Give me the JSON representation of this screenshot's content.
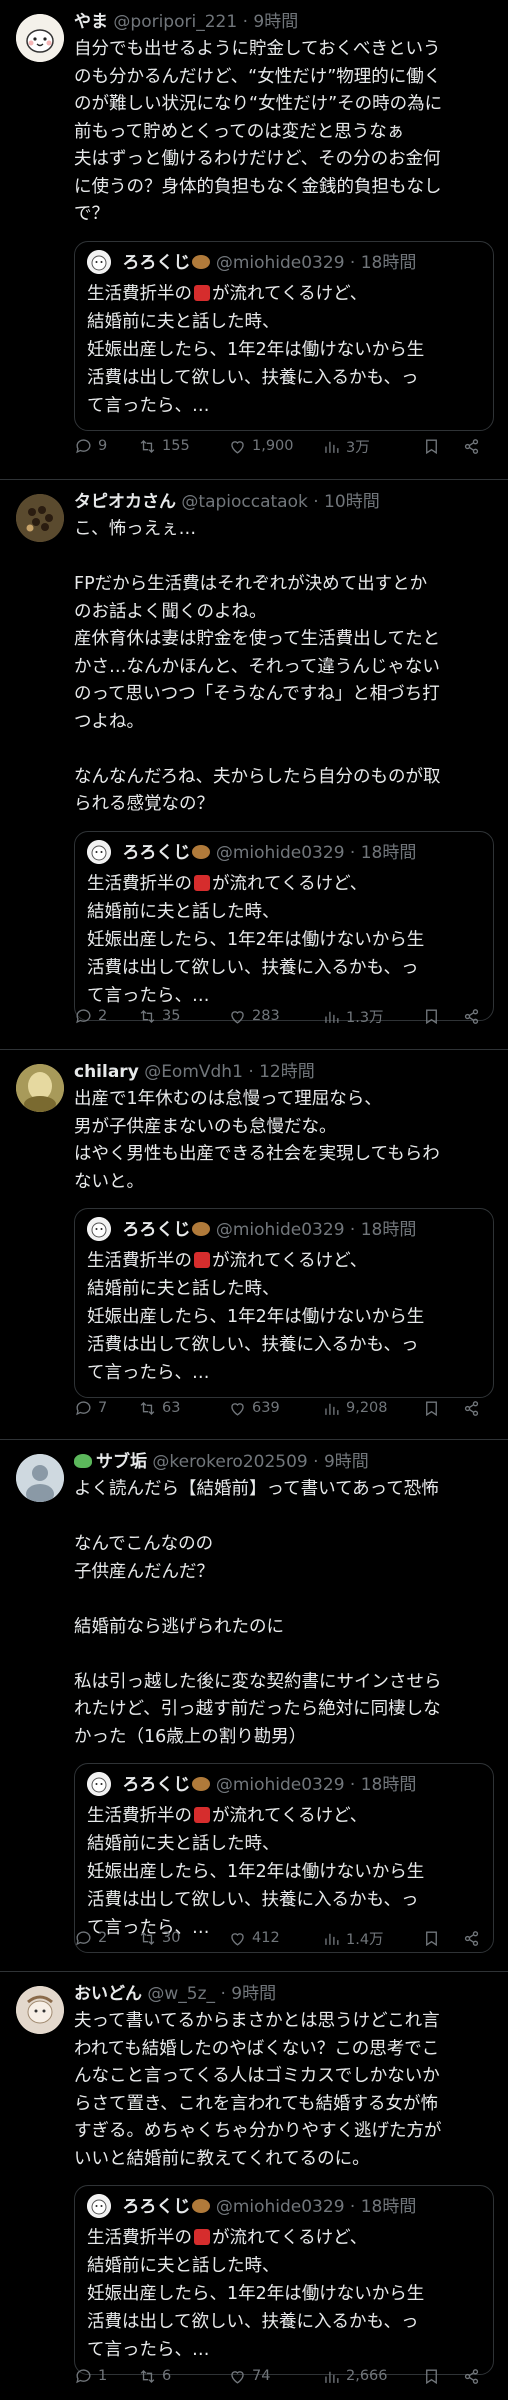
{
  "colors": {
    "background": "#000000",
    "text": "#e7e9ea",
    "muted": "#71767b",
    "border": "#2f3336"
  },
  "tweets": [
    {
      "name": "やま",
      "handle": "@poripori_221",
      "time": "· 9時間",
      "text": "自分でも出せるように貯金しておくべきという\nのも分かるんだけど、“女性だけ”物理的に働く\nのが難しい状況になり“女性だけ”その時の為に\n前もって貯めとくってのは変だと思うなぁ\n夫はずっと働けるわけだけど、その分のお金何\nに使うの？身体的負担もなく金銭的負担もなし\nで？",
      "quote": {
        "name": "ろろくじ",
        "handle": "@miohide0329",
        "time": "· 18時間",
        "line1_pre": "生活費折半の",
        "line1_post": "が流れてくるけど、",
        "rest": "結婚前に夫と話した時、\n妊娠出産したら、1年2年は働けないから生\n活費は出して欲しい、扶養に入るかも、っ\nて言ったら、…"
      },
      "replies": "9",
      "retweets": "155",
      "likes": "1,900",
      "views": "3万"
    },
    {
      "name": "タピオカさん",
      "handle": "@tapioccataok",
      "time": "· 10時間",
      "text": "こ、怖っえぇ…\n\nFPだから生活費はそれぞれが決めて出すとか\nのお話よく聞くのよね。\n産休育休は妻は貯金を使って生活費出してたと\nかさ…なんかほんと、それって違うんじゃない\nのって思いつつ「そうなんですね」と相づち打\nつよね。\n\nなんなんだろね、夫からしたら自分のものが取\nられる感覚なの？",
      "quote": {
        "name": "ろろくじ",
        "handle": "@miohide0329",
        "time": "· 18時間",
        "line1_pre": "生活費折半の",
        "line1_post": "が流れてくるけど、",
        "rest": "結婚前に夫と話した時、\n妊娠出産したら、1年2年は働けないから生\n活費は出して欲しい、扶養に入るかも、っ\nて言ったら、…"
      },
      "replies": "2",
      "retweets": "35",
      "likes": "283",
      "views": "1.3万"
    },
    {
      "name": "chilary",
      "handle": "@EomVdh1",
      "time": "· 12時間",
      "text": "出産で1年休むのは怠慢って理屈なら、\n男が子供産まないのも怠慢だな。\nはやく男性も出産できる社会を実現してもらわ\nないと。",
      "quote": {
        "name": "ろろくじ",
        "handle": "@miohide0329",
        "time": "· 18時間",
        "line1_pre": "生活費折半の",
        "line1_post": "が流れてくるけど、",
        "rest": "結婚前に夫と話した時、\n妊娠出産したら、1年2年は働けないから生\n活費は出して欲しい、扶養に入るかも、っ\nて言ったら、…"
      },
      "replies": "7",
      "retweets": "63",
      "likes": "639",
      "views": "9,208"
    },
    {
      "name": "サブ垢",
      "handle": "@kerokero202509",
      "time": "· 9時間",
      "text": "よく読んだら【結婚前】って書いてあって恐怖\n\nなんでこんなのの\n子供産んだんだ？\n\n結婚前なら逃げられたのに\n\n私は引っ越した後に変な契約書にサインさせら\nれたけど、引っ越す前だったら絶対に同棲しな\nかった（16歳上の割り勘男）",
      "quote": {
        "name": "ろろくじ",
        "handle": "@miohide0329",
        "time": "· 18時間",
        "line1_pre": "生活費折半の",
        "line1_post": "が流れてくるけど、",
        "rest": "結婚前に夫と話した時、\n妊娠出産したら、1年2年は働けないから生\n活費は出して欲しい、扶養に入るかも、っ\nて言ったら、…"
      },
      "replies": "2",
      "retweets": "30",
      "likes": "412",
      "views": "1.4万"
    },
    {
      "name": "おいどん",
      "handle": "@w_5z_",
      "time": "· 9時間",
      "text": "夫って書いてるからまさかとは思うけどこれ言\nわれても結婚したのやばくない？この思考でこ\nんなこと言ってくる人はゴミカスでしかないか\nらさて置き、これを言われても結婚する女が怖\nすぎる。めちゃくちゃ分かりやすく逃げた方が\nいいと結婚前に教えてくれてるのに。",
      "quote": {
        "name": "ろろくじ",
        "handle": "@miohide0329",
        "time": "· 18時間",
        "line1_pre": "生活費折半の",
        "line1_post": "が流れてくるけど、",
        "rest": "結婚前に夫と話した時、\n妊娠出産したら、1年2年は働けないから生\n活費は出して欲しい、扶養に入るかも、っ\nて言ったら、…"
      },
      "replies": "1",
      "retweets": "6",
      "likes": "74",
      "views": "2,666"
    }
  ]
}
